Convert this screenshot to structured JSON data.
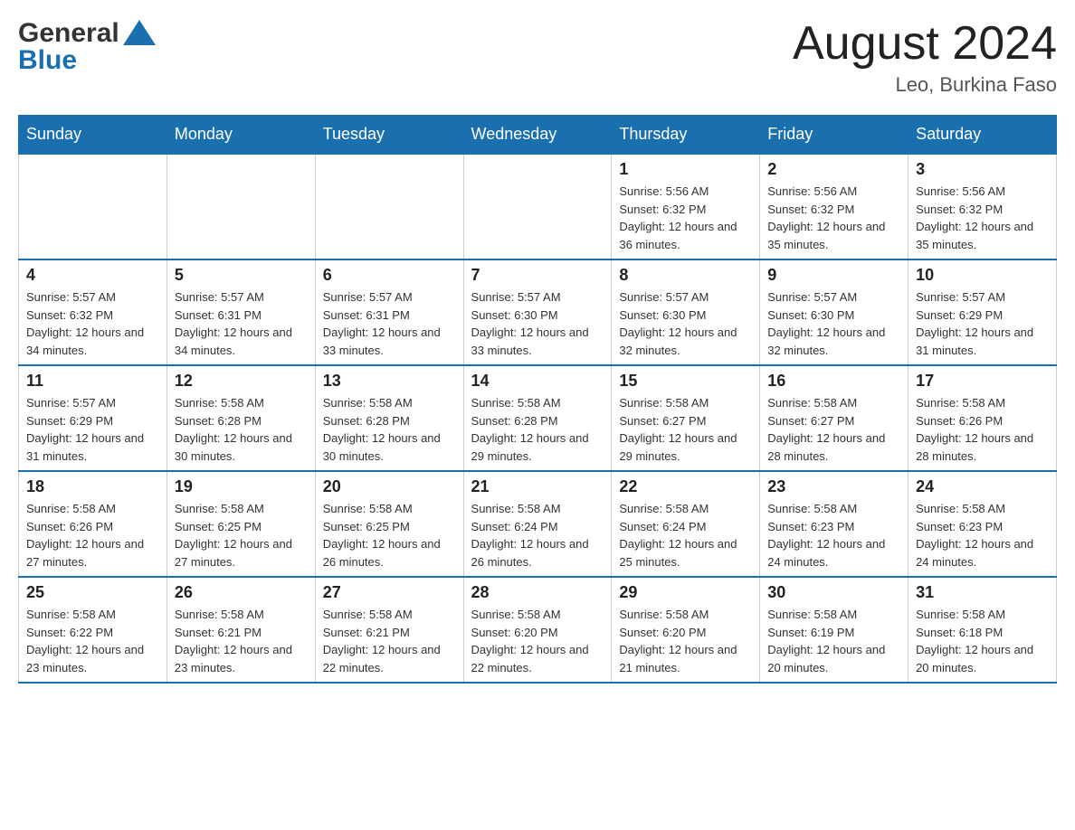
{
  "header": {
    "logo_general": "General",
    "logo_blue": "Blue",
    "month_title": "August 2024",
    "location": "Leo, Burkina Faso"
  },
  "weekdays": [
    "Sunday",
    "Monday",
    "Tuesday",
    "Wednesday",
    "Thursday",
    "Friday",
    "Saturday"
  ],
  "weeks": [
    [
      {
        "day": "",
        "info": ""
      },
      {
        "day": "",
        "info": ""
      },
      {
        "day": "",
        "info": ""
      },
      {
        "day": "",
        "info": ""
      },
      {
        "day": "1",
        "info": "Sunrise: 5:56 AM\nSunset: 6:32 PM\nDaylight: 12 hours and 36 minutes."
      },
      {
        "day": "2",
        "info": "Sunrise: 5:56 AM\nSunset: 6:32 PM\nDaylight: 12 hours and 35 minutes."
      },
      {
        "day": "3",
        "info": "Sunrise: 5:56 AM\nSunset: 6:32 PM\nDaylight: 12 hours and 35 minutes."
      }
    ],
    [
      {
        "day": "4",
        "info": "Sunrise: 5:57 AM\nSunset: 6:32 PM\nDaylight: 12 hours and 34 minutes."
      },
      {
        "day": "5",
        "info": "Sunrise: 5:57 AM\nSunset: 6:31 PM\nDaylight: 12 hours and 34 minutes."
      },
      {
        "day": "6",
        "info": "Sunrise: 5:57 AM\nSunset: 6:31 PM\nDaylight: 12 hours and 33 minutes."
      },
      {
        "day": "7",
        "info": "Sunrise: 5:57 AM\nSunset: 6:30 PM\nDaylight: 12 hours and 33 minutes."
      },
      {
        "day": "8",
        "info": "Sunrise: 5:57 AM\nSunset: 6:30 PM\nDaylight: 12 hours and 32 minutes."
      },
      {
        "day": "9",
        "info": "Sunrise: 5:57 AM\nSunset: 6:30 PM\nDaylight: 12 hours and 32 minutes."
      },
      {
        "day": "10",
        "info": "Sunrise: 5:57 AM\nSunset: 6:29 PM\nDaylight: 12 hours and 31 minutes."
      }
    ],
    [
      {
        "day": "11",
        "info": "Sunrise: 5:57 AM\nSunset: 6:29 PM\nDaylight: 12 hours and 31 minutes."
      },
      {
        "day": "12",
        "info": "Sunrise: 5:58 AM\nSunset: 6:28 PM\nDaylight: 12 hours and 30 minutes."
      },
      {
        "day": "13",
        "info": "Sunrise: 5:58 AM\nSunset: 6:28 PM\nDaylight: 12 hours and 30 minutes."
      },
      {
        "day": "14",
        "info": "Sunrise: 5:58 AM\nSunset: 6:28 PM\nDaylight: 12 hours and 29 minutes."
      },
      {
        "day": "15",
        "info": "Sunrise: 5:58 AM\nSunset: 6:27 PM\nDaylight: 12 hours and 29 minutes."
      },
      {
        "day": "16",
        "info": "Sunrise: 5:58 AM\nSunset: 6:27 PM\nDaylight: 12 hours and 28 minutes."
      },
      {
        "day": "17",
        "info": "Sunrise: 5:58 AM\nSunset: 6:26 PM\nDaylight: 12 hours and 28 minutes."
      }
    ],
    [
      {
        "day": "18",
        "info": "Sunrise: 5:58 AM\nSunset: 6:26 PM\nDaylight: 12 hours and 27 minutes."
      },
      {
        "day": "19",
        "info": "Sunrise: 5:58 AM\nSunset: 6:25 PM\nDaylight: 12 hours and 27 minutes."
      },
      {
        "day": "20",
        "info": "Sunrise: 5:58 AM\nSunset: 6:25 PM\nDaylight: 12 hours and 26 minutes."
      },
      {
        "day": "21",
        "info": "Sunrise: 5:58 AM\nSunset: 6:24 PM\nDaylight: 12 hours and 26 minutes."
      },
      {
        "day": "22",
        "info": "Sunrise: 5:58 AM\nSunset: 6:24 PM\nDaylight: 12 hours and 25 minutes."
      },
      {
        "day": "23",
        "info": "Sunrise: 5:58 AM\nSunset: 6:23 PM\nDaylight: 12 hours and 24 minutes."
      },
      {
        "day": "24",
        "info": "Sunrise: 5:58 AM\nSunset: 6:23 PM\nDaylight: 12 hours and 24 minutes."
      }
    ],
    [
      {
        "day": "25",
        "info": "Sunrise: 5:58 AM\nSunset: 6:22 PM\nDaylight: 12 hours and 23 minutes."
      },
      {
        "day": "26",
        "info": "Sunrise: 5:58 AM\nSunset: 6:21 PM\nDaylight: 12 hours and 23 minutes."
      },
      {
        "day": "27",
        "info": "Sunrise: 5:58 AM\nSunset: 6:21 PM\nDaylight: 12 hours and 22 minutes."
      },
      {
        "day": "28",
        "info": "Sunrise: 5:58 AM\nSunset: 6:20 PM\nDaylight: 12 hours and 22 minutes."
      },
      {
        "day": "29",
        "info": "Sunrise: 5:58 AM\nSunset: 6:20 PM\nDaylight: 12 hours and 21 minutes."
      },
      {
        "day": "30",
        "info": "Sunrise: 5:58 AM\nSunset: 6:19 PM\nDaylight: 12 hours and 20 minutes."
      },
      {
        "day": "31",
        "info": "Sunrise: 5:58 AM\nSunset: 6:18 PM\nDaylight: 12 hours and 20 minutes."
      }
    ]
  ]
}
